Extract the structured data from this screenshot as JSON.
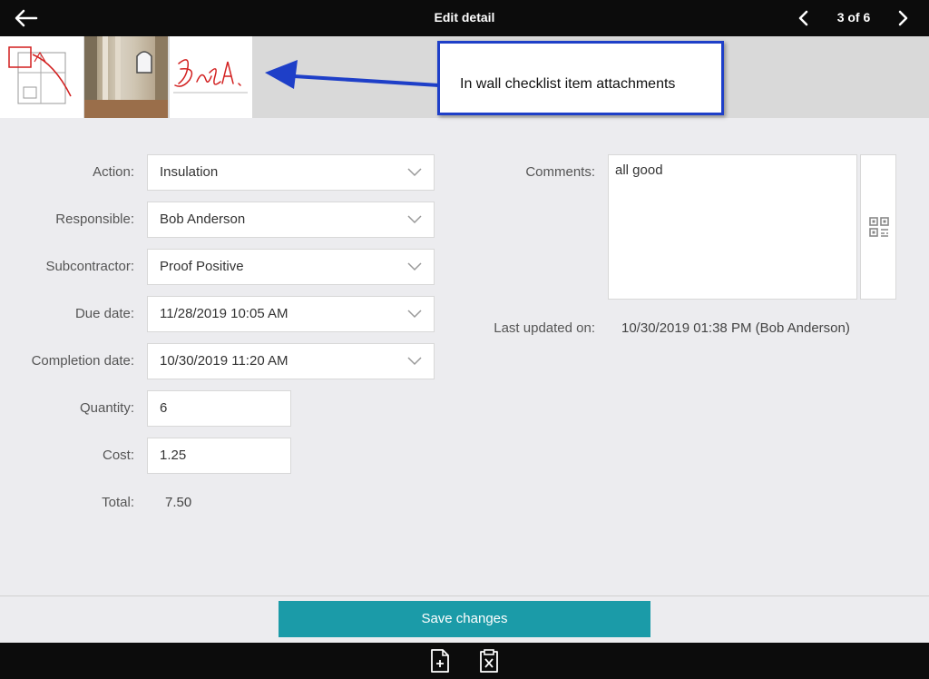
{
  "header": {
    "title": "Edit detail",
    "pager": "3 of 6"
  },
  "callout": {
    "text": "In wall checklist item attachments",
    "color": "#1e3fc8"
  },
  "form": {
    "action": {
      "label": "Action:",
      "value": "Insulation"
    },
    "responsible": {
      "label": "Responsible:",
      "value": "Bob Anderson"
    },
    "subcontractor": {
      "label": "Subcontractor:",
      "value": "Proof Positive"
    },
    "due_date": {
      "label": "Due date:",
      "value": "11/28/2019 10:05 AM"
    },
    "completion_date": {
      "label": "Completion date:",
      "value": "10/30/2019 11:20 AM"
    },
    "quantity": {
      "label": "Quantity:",
      "value": "6"
    },
    "cost": {
      "label": "Cost:",
      "value": "1.25"
    },
    "total": {
      "label": "Total:",
      "value": "7.50"
    },
    "comments": {
      "label": "Comments:",
      "value": "all good"
    },
    "last_updated": {
      "label": "Last updated on:",
      "value": "10/30/2019 01:38 PM (Bob Anderson)"
    }
  },
  "footer": {
    "save_label": "Save changes",
    "accent": "#1b9ba8"
  },
  "icons": [
    "back-arrow-icon",
    "chevron-left-icon",
    "chevron-right-icon",
    "chevron-down-icon",
    "qr-code-icon",
    "new-file-icon",
    "clipboard-x-icon"
  ]
}
